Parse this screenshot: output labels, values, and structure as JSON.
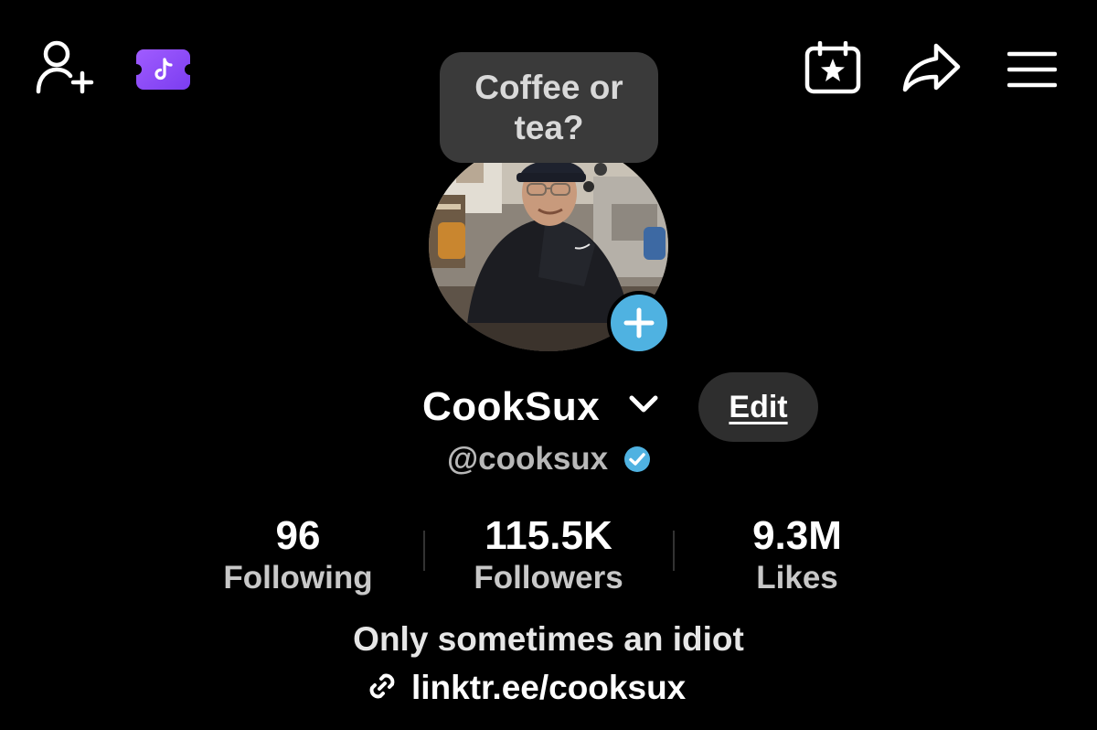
{
  "top_bar": {
    "add_friends_icon": "person-plus-icon",
    "ticket_icon": "tiktok-ticket-icon",
    "calendar_icon": "calendar-star-icon",
    "share_icon": "share-arrow-icon",
    "menu_icon": "hamburger-menu-icon"
  },
  "bubble": {
    "text": "Coffee or tea?"
  },
  "profile": {
    "display_name": "CookSux",
    "username": "@cooksux",
    "verified": true,
    "edit_label": "Edit",
    "bio": "Only sometimes an idiot",
    "link": "linktr.ee/cooksux"
  },
  "stats": [
    {
      "value": "96",
      "label": "Following"
    },
    {
      "value": "115.5K",
      "label": "Followers"
    },
    {
      "value": "9.3M",
      "label": "Likes"
    }
  ],
  "colors": {
    "background": "#000000",
    "accent_blue": "#4fb2e1",
    "ticket_purple": "#8b4dff",
    "edit_button_bg": "#2e2e2e",
    "bubble_bg": "#3a3a3a"
  }
}
